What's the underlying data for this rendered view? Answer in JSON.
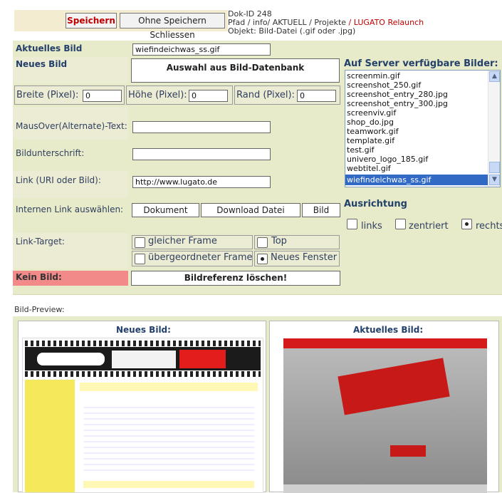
{
  "toolbar": {
    "save_label": "Speichern",
    "close_label": "Ohne Speichern Schliessen"
  },
  "meta": {
    "doc_id": "Dok-ID 248",
    "path_prefix": "Pfad / info/ AKTUELL / Projekte",
    "path_current": " / LUGATO Relaunch",
    "object": "Objekt: Bild-Datei (.gif oder .jpg)"
  },
  "form": {
    "current_image_label": "Aktuelles Bild",
    "current_image_value": "wiefindeichwas_ss.gif",
    "new_image_label": "Neues Bild",
    "select_db_button": "Auswahl aus Bild-Datenbank",
    "width_label": "Breite (Pixel):",
    "width_value": "0",
    "height_label": "Höhe (Pixel):",
    "height_value": "0",
    "border_label": "Rand (Pixel):",
    "border_value": "0",
    "alt_label": "MausOver(Alternate)-Text:",
    "alt_value": "",
    "caption_label": "Bildunterschrift:",
    "caption_value": "",
    "link_label": "Link (URI oder Bild):",
    "link_value": "http://www.lugato.de",
    "internal_link_label": "Internen Link auswählen:",
    "internal_buttons": [
      "Dokument",
      "Download Datei",
      "Bild"
    ],
    "target_label": "Link-Target:",
    "target_options": [
      "gleicher Frame",
      "Top",
      "übergeordneter Frame",
      "Neues Fenster"
    ],
    "target_selected": "Neues Fenster",
    "no_image_label": "Kein Bild:",
    "delete_ref_button": "Bildreferenz löschen!"
  },
  "server_images": {
    "heading": "Auf Server verfügbare Bilder:",
    "items": [
      "screenmin.gif",
      "screenshot_250.gif",
      "screenshot_entry_280.jpg",
      "screenshot_entry_300.jpg",
      "screenviv.gif",
      "shop_do.jpg",
      "teamwork.gif",
      "template.gif",
      "test.gif",
      "univero_logo_185.gif",
      "webtitel.gif",
      "wiefindeichwas_ss.gif"
    ],
    "selected": "wiefindeichwas_ss.gif"
  },
  "alignment": {
    "heading": "Ausrichtung",
    "options": [
      "links",
      "zentriert",
      "rechts"
    ],
    "selected": "rechts"
  },
  "preview": {
    "title": "Bild-Preview:",
    "new_label": "Neues Bild:",
    "current_label": "Aktuelles Bild:"
  },
  "colors": {
    "accent_red": "#c00000",
    "heading_blue": "#23406b",
    "panel_bg": "#e8ebc9",
    "kein_bild_bg": "#f28a8a",
    "selected_blue": "#316ac5"
  }
}
